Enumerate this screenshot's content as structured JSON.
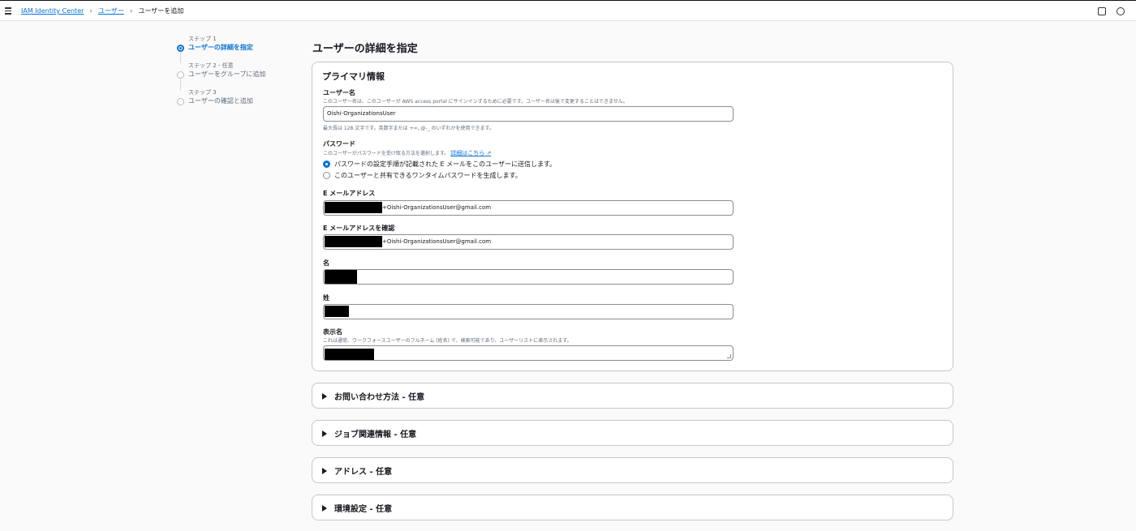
{
  "breadcrumb": {
    "items": [
      "IAM Identity Center",
      "ユーザー"
    ],
    "current": "ユーザーを追加"
  },
  "steps": [
    {
      "label": "ステップ 1",
      "title": "ユーザーの詳細を指定",
      "active": true
    },
    {
      "label": "ステップ 2 - 任意",
      "title": "ユーザーをグループに追加",
      "active": false
    },
    {
      "label": "ステップ 3",
      "title": "ユーザーの確認と追加",
      "active": false
    }
  ],
  "page_title": "ユーザーの詳細を指定",
  "primary": {
    "heading": "プライマリ情報",
    "username": {
      "label": "ユーザー名",
      "description": "このユーザー名は、このユーザーが AWS access portal にサインインするために必要です。ユーザー名は後で変更することはできません。",
      "value": "Oishi-OrganizationsUser",
      "hint": "最大長は 128 文字です。英数字または +=,.@-_ のいずれかを使用できます。"
    },
    "password": {
      "label": "パスワード",
      "description": "このユーザーがパスワードを受け取る方法を選択します。",
      "learn_more": "詳細はこちら",
      "options": [
        "パスワードの設定手順が記載された E メールをこのユーザーに送信します。",
        "このユーザーと共有できるワンタイムパスワードを生成します。"
      ],
      "selected": 0
    },
    "email": {
      "label": "E メールアドレス",
      "value_suffix": "+Oishi-OrganizationsUser@gmail.com"
    },
    "email_confirm": {
      "label": "E メールアドレスを確認",
      "value_suffix": "+Oishi-OrganizationsUser@gmail.com"
    },
    "first_name": {
      "label": "名"
    },
    "last_name": {
      "label": "姓"
    },
    "display_name": {
      "label": "表示名",
      "description": "これは通常、ワークフォースユーザーのフルネーム (姓名) で、検索可能であり、ユーザーリストに表示されます。"
    }
  },
  "sections": [
    "お問い合わせ方法 - 任意",
    "ジョブ関連情報 - 任意",
    "アドレス - 任意",
    "環境設定 - 任意"
  ],
  "colors": {
    "accent": "#0972d3",
    "text": "#16191f",
    "muted": "#5f6b7a"
  },
  "icons": [
    "menu-icon",
    "external-link-icon",
    "panel-icon",
    "settings-icon",
    "chevron-right-icon",
    "caret-right-icon"
  ]
}
